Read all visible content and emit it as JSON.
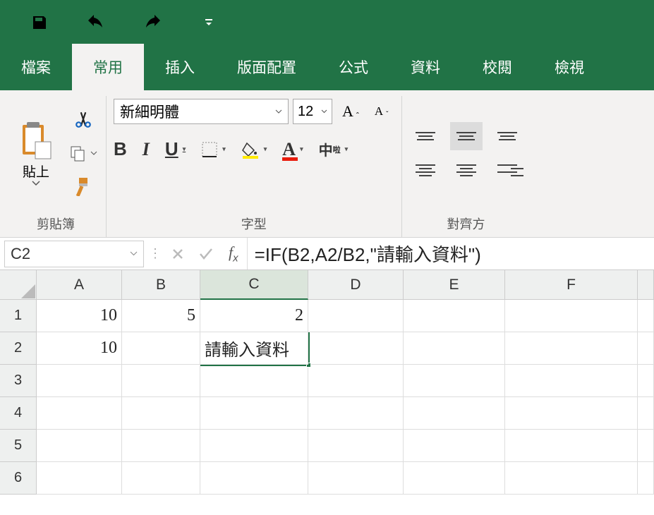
{
  "qat": {
    "save": "save-icon",
    "undo": "undo-icon",
    "redo": "redo-icon"
  },
  "tabs": {
    "file": "檔案",
    "home": "常用",
    "insert": "插入",
    "pagelayout": "版面配置",
    "formulas": "公式",
    "data": "資料",
    "review": "校閱",
    "view": "檢視"
  },
  "ribbon": {
    "clipboard": {
      "title": "剪貼簿",
      "paste": "貼上"
    },
    "font": {
      "title": "字型",
      "family": "新細明體",
      "size": "12",
      "bold": "B",
      "italic": "I",
      "underline": "U",
      "phonetic": "中"
    },
    "align": {
      "title": "對齊方"
    }
  },
  "namebox": "C2",
  "formula_bar": "=IF(B2,A2/B2,\"請輸入資料\")",
  "columns": [
    "A",
    "B",
    "C",
    "D",
    "E",
    "F"
  ],
  "rows": [
    "1",
    "2",
    "3",
    "4",
    "5",
    "6"
  ],
  "cells": {
    "A1": "10",
    "B1": "5",
    "C1": "2",
    "A2": "10",
    "C2": "請輸入資料"
  },
  "active_cell": "C2"
}
